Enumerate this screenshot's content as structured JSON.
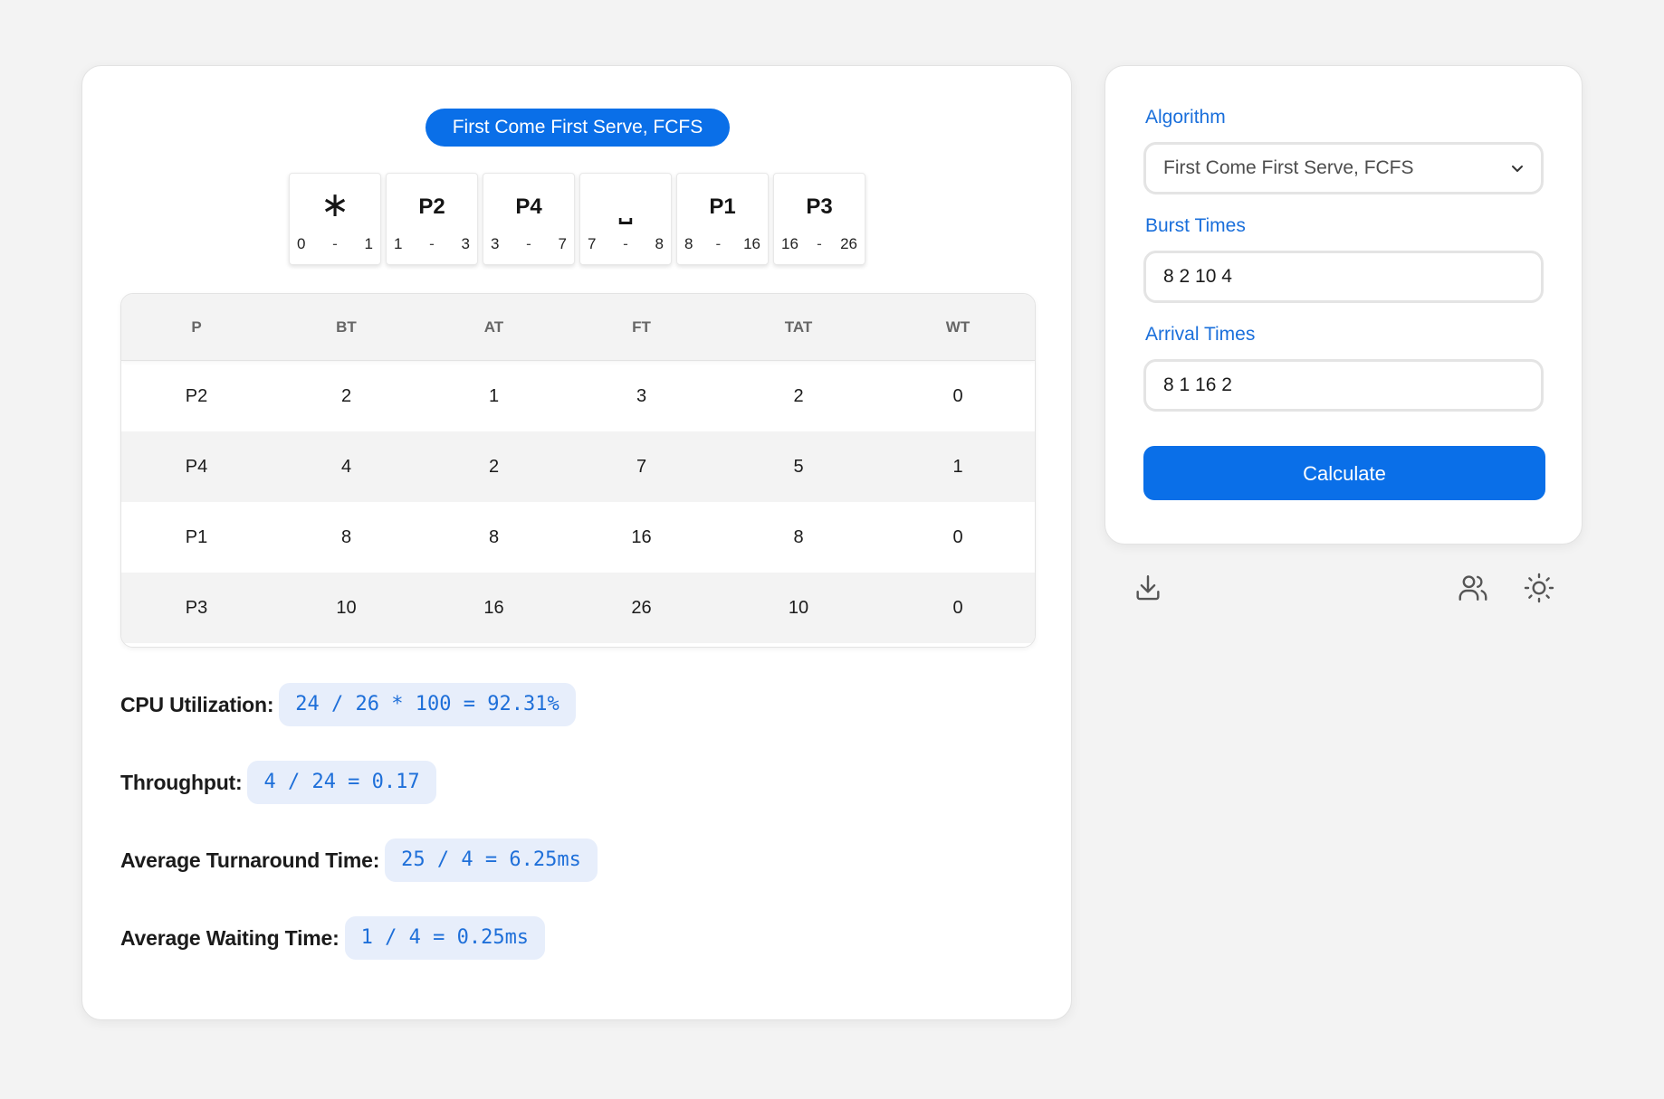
{
  "result": {
    "algorithm_badge": "First Come First Serve, FCFS",
    "gantt": [
      {
        "label": "∗",
        "start": "0",
        "end": "1",
        "type": "symbol"
      },
      {
        "label": "P2",
        "start": "1",
        "end": "3",
        "type": "process"
      },
      {
        "label": "P4",
        "start": "3",
        "end": "7",
        "type": "process"
      },
      {
        "label": "⎵",
        "start": "7",
        "end": "8",
        "type": "symbol"
      },
      {
        "label": "P1",
        "start": "8",
        "end": "16",
        "type": "process"
      },
      {
        "label": "P3",
        "start": "16",
        "end": "26",
        "type": "process"
      }
    ],
    "gantt_dash": "-",
    "table": {
      "headers": [
        "P",
        "BT",
        "AT",
        "FT",
        "TAT",
        "WT"
      ],
      "rows": [
        [
          "P2",
          "2",
          "1",
          "3",
          "2",
          "0"
        ],
        [
          "P4",
          "4",
          "2",
          "7",
          "5",
          "1"
        ],
        [
          "P1",
          "8",
          "8",
          "16",
          "8",
          "0"
        ],
        [
          "P3",
          "10",
          "16",
          "26",
          "10",
          "0"
        ]
      ]
    },
    "metrics": {
      "cpu_label": "CPU Utilization:",
      "cpu_value": "24 / 26 * 100 = 92.31%",
      "throughput_label": "Throughput:",
      "throughput_value": "4 / 24 = 0.17",
      "tat_label": "Average Turnaround Time:",
      "tat_value": "25 / 4 = 6.25ms",
      "wt_label": "Average Waiting Time:",
      "wt_value": "1 / 4 = 0.25ms"
    }
  },
  "settings": {
    "algorithm_label": "Algorithm",
    "algorithm_selected": "First Come First Serve, FCFS",
    "burst_label": "Burst Times",
    "burst_value": "8 2 10 4",
    "arrival_label": "Arrival Times",
    "arrival_value": "8 1 16 2",
    "calculate_label": "Calculate"
  },
  "icons": {
    "download": "download-icon",
    "users": "users-icon",
    "theme": "sun-icon"
  },
  "colors": {
    "accent": "#0a6fe8",
    "label_blue": "#1a6fdb",
    "metric_bg": "#e7eefb",
    "background": "#f3f3f3"
  }
}
